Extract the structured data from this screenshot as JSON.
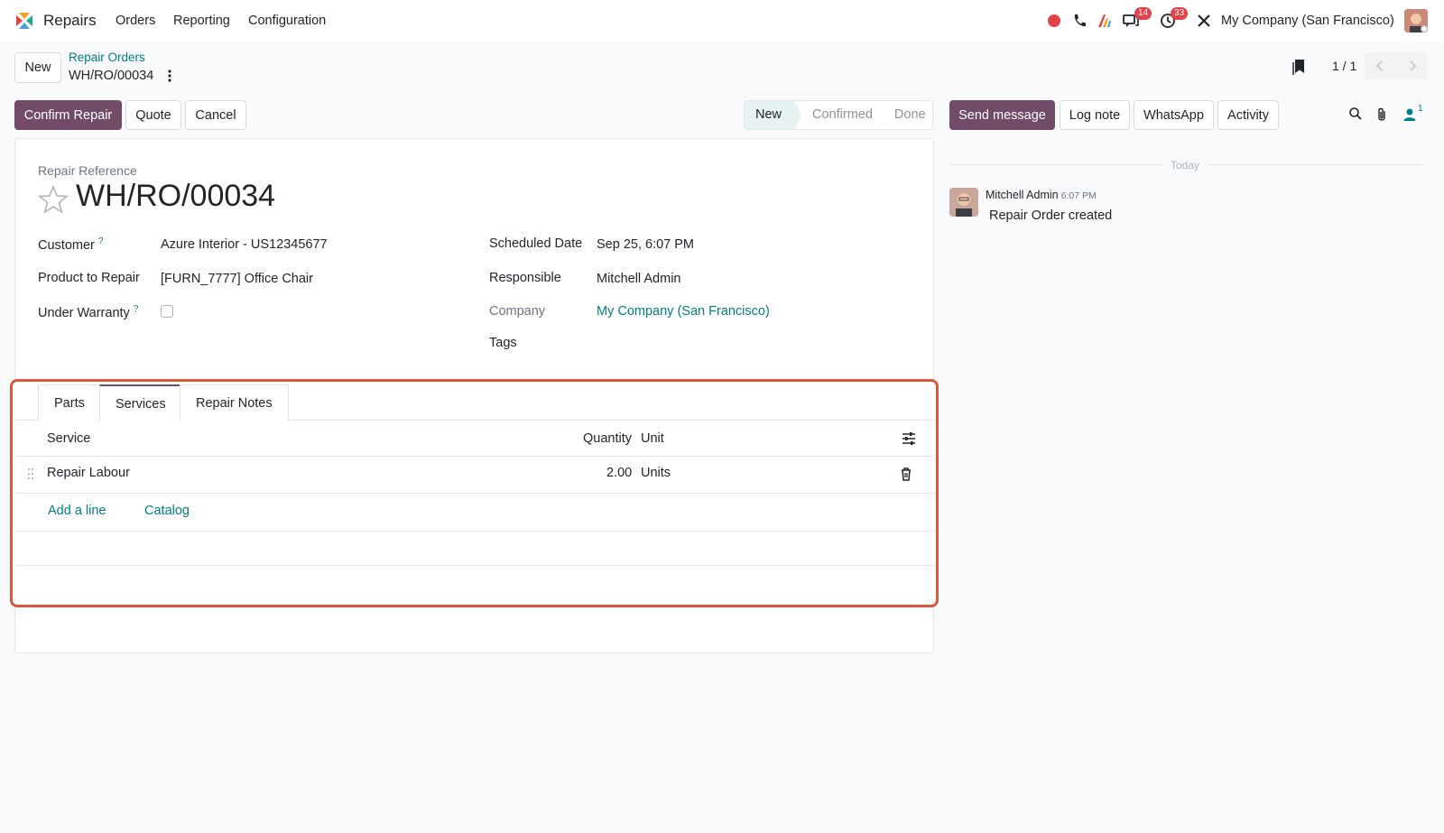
{
  "navbar": {
    "app_name": "Repairs",
    "menu": [
      "Orders",
      "Reporting",
      "Configuration"
    ],
    "messages_badge": "14",
    "activities_badge": "33",
    "company": "My Company (San Francisco)"
  },
  "control_panel": {
    "new_label": "New",
    "breadcrumb_parent": "Repair Orders",
    "breadcrumb_current": "WH/RO/00034",
    "pager": "1 / 1"
  },
  "actions": {
    "confirm": "Confirm Repair",
    "quote": "Quote",
    "cancel": "Cancel"
  },
  "status": {
    "stages": [
      "New",
      "Confirmed",
      "Done"
    ],
    "active": "New"
  },
  "form": {
    "reference_label": "Repair Reference",
    "reference": "WH/RO/00034",
    "customer_label": "Customer",
    "customer": "Azure Interior - US12345677",
    "product_label": "Product to Repair",
    "product": "[FURN_7777] Office Chair",
    "warranty_label": "Under Warranty",
    "help_mark": "?",
    "scheduled_label": "Scheduled Date",
    "scheduled": "Sep 25, 6:07 PM",
    "responsible_label": "Responsible",
    "responsible": "Mitchell Admin",
    "company_label": "Company",
    "company": "My Company (San Francisco)",
    "tags_label": "Tags"
  },
  "notebook": {
    "tabs": [
      "Parts",
      "Services",
      "Repair Notes"
    ],
    "active_tab": "Services",
    "columns": {
      "service": "Service",
      "quantity": "Quantity",
      "unit": "Unit"
    },
    "rows": [
      {
        "service": "Repair Labour",
        "quantity": "2.00",
        "unit": "Units"
      }
    ],
    "add_line": "Add a line",
    "catalog": "Catalog"
  },
  "chatter": {
    "send_message": "Send message",
    "log_note": "Log note",
    "whatsapp": "WhatsApp",
    "activity": "Activity",
    "followers_count": "1",
    "date_separator": "Today",
    "messages": [
      {
        "author": "Mitchell Admin",
        "time": "6:07 PM",
        "body": "Repair Order created"
      }
    ]
  },
  "colors": {
    "primary": "#714b67",
    "link": "#017e84",
    "highlight": "#d9593a",
    "record_dot": "#e0444a"
  }
}
